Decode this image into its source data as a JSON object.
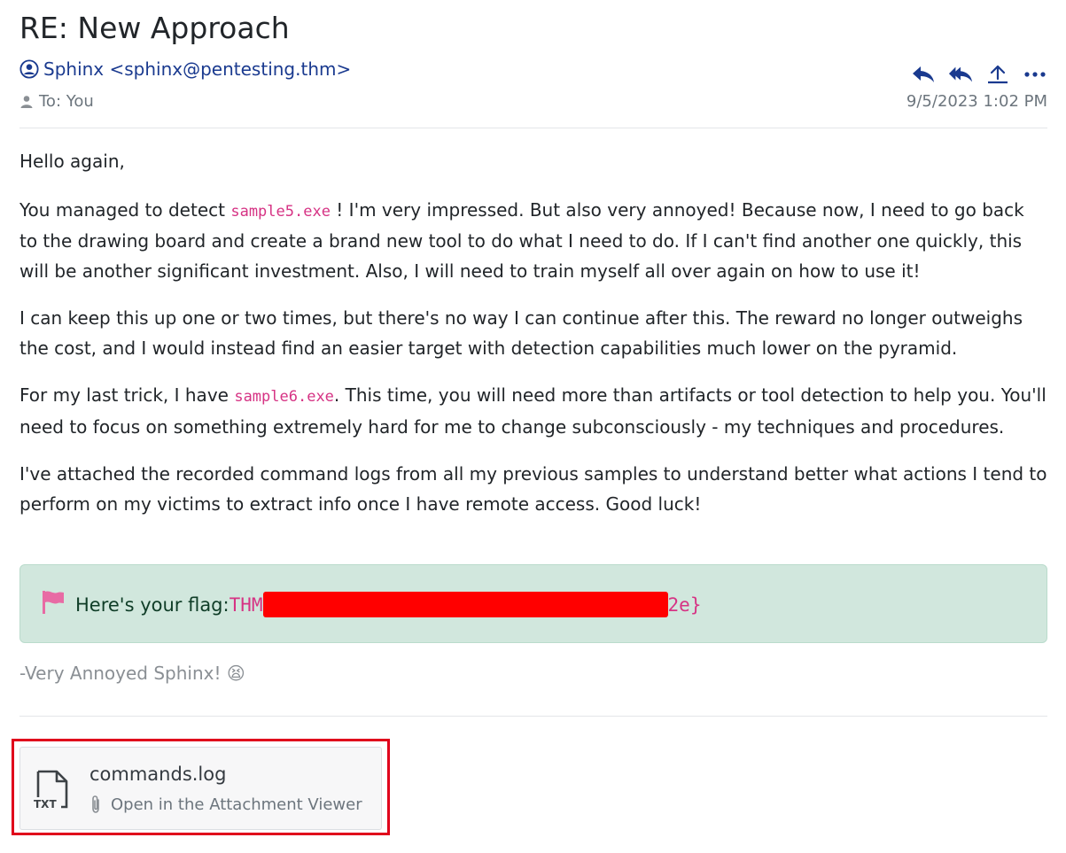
{
  "email": {
    "subject": "RE: New Approach",
    "sender": "Sphinx <sphinx@pentesting.thm>",
    "to": "To: You",
    "date": "9/5/2023 1:02 PM"
  },
  "actions": {
    "icons": [
      "reply-icon",
      "reply-all-icon",
      "share-icon",
      "more-icon"
    ]
  },
  "body": {
    "greeting": "Hello again,",
    "p1_before": "You managed to detect ",
    "p1_code": "sample5.exe",
    "p1_after": " ! I'm very impressed. But also very annoyed! Because now, I need to go back to the drawing board and create a brand new tool to do what I need to do. If I can't find another one quickly, this will be another significant investment. Also, I will need to train myself all over again on how to use it!",
    "p2": "I can keep this up one or two times, but there's no way I can continue after this. The reward no longer outweighs the cost, and I would instead find an easier target with detection capabilities much lower on the pyramid.",
    "p3_before": "For my last trick, I have ",
    "p3_code": "sample6.exe",
    "p3_after": ". This time, you will need more than artifacts or tool detection to help you. You'll need to focus on something extremely hard for me to change subconsciously - my techniques and procedures.",
    "p4": "I've attached the recorded command logs from all my previous samples to understand better what actions I tend to perform on my victims to extract info once I have remote access. Good luck!"
  },
  "flag": {
    "label": "Here's your flag: ",
    "prefix": "THM",
    "suffix": "2e}"
  },
  "signature": "-Very Annoyed Sphinx! 😫",
  "attachment": {
    "type_label": "TXT",
    "filename": "commands.log",
    "open_label": "Open in the Attachment Viewer"
  },
  "colors": {
    "accent": "#1a3a8f",
    "code": "#d63384",
    "flag_bg": "#d1e7dd",
    "redaction": "#ff0000",
    "highlight_border": "#e0001b"
  }
}
